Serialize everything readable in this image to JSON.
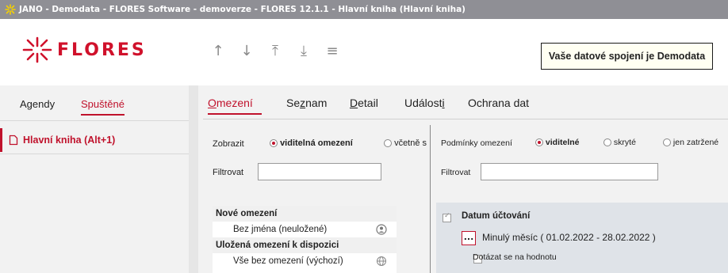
{
  "window": {
    "title": "JANO - Demodata - FLORES Software - demoverze - FLORES 12.1.1 - Hlavní kniha  (Hlavní kniha)"
  },
  "header": {
    "logo_text": "FLORES",
    "connection_notice": "Vaše datové spojení je Demodata",
    "nav_icons": [
      "arrow-up-icon",
      "arrow-down-icon",
      "arrow-to-top-icon",
      "arrow-to-bottom-icon",
      "menu-icon"
    ]
  },
  "left_panel": {
    "tabs": [
      {
        "label": "Agendy",
        "active": false
      },
      {
        "label": "Spuštěné",
        "active": true
      }
    ],
    "items": [
      {
        "label": "Hlavní kniha (Alt+1)",
        "icon": "document-icon"
      }
    ]
  },
  "main": {
    "tabs": [
      {
        "label_accel": "O",
        "label_rest": "mezení",
        "active": true
      },
      {
        "label_pre": "Se",
        "label_accel": "z",
        "label_rest": "nam",
        "active": false
      },
      {
        "label_accel": "D",
        "label_rest": "etail",
        "active": false
      },
      {
        "label_pre": "Událost",
        "label_accel": "i",
        "label_rest": "",
        "active": false
      },
      {
        "label": "Ochrana dat",
        "active": false
      }
    ],
    "left_section": {
      "show_label": "Zobrazit",
      "show_options": [
        {
          "label": "viditelná omezení",
          "selected": true
        },
        {
          "label": "včetně s",
          "selected": false
        }
      ],
      "filter_label": "Filtrovat",
      "filter_value": "",
      "list": {
        "new_header": "Nové omezení",
        "new_item": {
          "label": "Bez jména (neuložené)",
          "icon": "user-icon"
        },
        "saved_header": "Uložená omezení k dispozici",
        "saved_item": {
          "label": "Vše bez omezení (výchozí)",
          "icon": "globe-icon"
        }
      }
    },
    "right_section": {
      "conditions_label": "Podmínky omezení",
      "condition_options": [
        {
          "label": "viditelné",
          "selected": true
        },
        {
          "label": "skryté",
          "selected": false
        },
        {
          "label": "jen zatržené",
          "selected": false
        }
      ],
      "filter_label": "Filtrovat",
      "filter_value": "",
      "condition": {
        "checked": true,
        "title": "Datum účtování",
        "button_label": "...",
        "value_text": "Minulý měsíc ( 01.02.2022 - 28.02.2022 )",
        "ask_label": "Dotázat se na hodnotu",
        "ask_checked": false
      }
    }
  },
  "colors": {
    "accent": "#c0122c",
    "titlebar": "#8f8f95",
    "notice_bg": "#fffff2"
  }
}
